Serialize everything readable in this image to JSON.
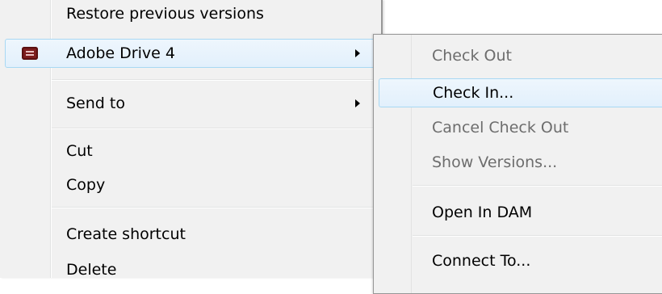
{
  "main_menu": {
    "restore_label": "Restore previous versions",
    "adobe_drive_label": "Adobe Drive 4",
    "send_to_label": "Send to",
    "cut_label": "Cut",
    "copy_label": "Copy",
    "create_shortcut_label": "Create shortcut",
    "delete_label": "Delete"
  },
  "submenu": {
    "check_out_label": "Check Out",
    "check_in_label": "Check In...",
    "cancel_check_out_label": "Cancel Check Out",
    "show_versions_label": "Show Versions...",
    "open_in_dam_label": "Open In DAM",
    "connect_to_label": "Connect To..."
  },
  "icons": {
    "adobe_drive": "adobe-drive-icon",
    "submenu_arrow": "chevron-right-icon"
  },
  "colors": {
    "highlight_border": "#a8d8f3",
    "highlight_fill": "#e6f2fc",
    "menu_background": "#f1f1f1",
    "disabled_text": "#6d6d6d"
  }
}
